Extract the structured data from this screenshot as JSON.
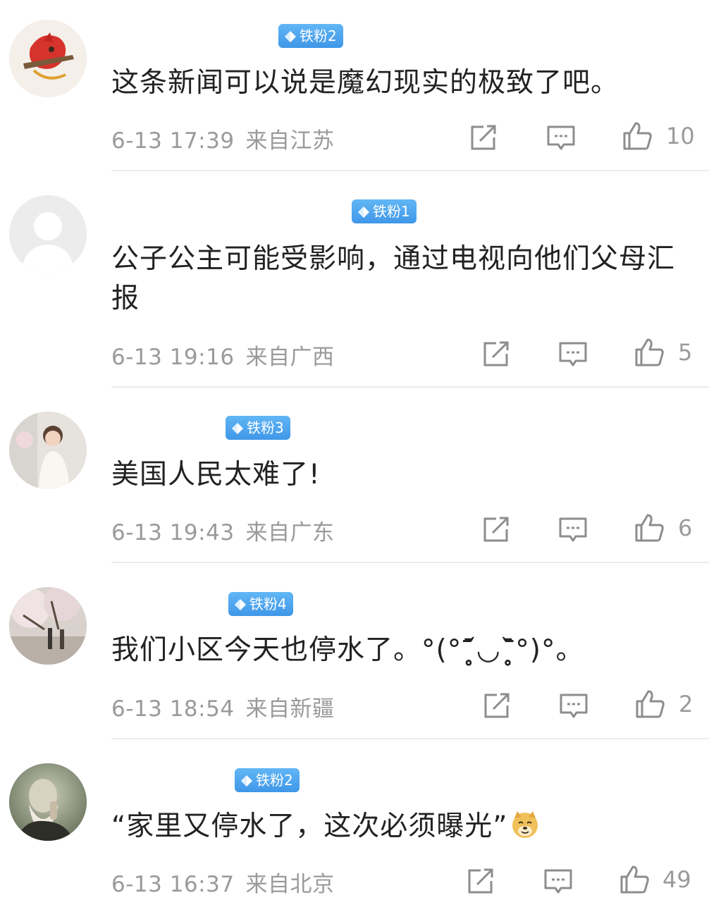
{
  "colors": {
    "badge": "#4aa3ee",
    "meta_text": "#9a9a9a",
    "body_text": "#222222",
    "divider": "#ececec"
  },
  "comments": [
    {
      "badge": "铁粉2",
      "text": "这条新闻可以说是魔幻现实的极致了吧。",
      "time": "6-13 17:39",
      "location": "来自江苏",
      "likes": "10",
      "avatar": "red-drawing-avatar"
    },
    {
      "badge": "铁粉1",
      "text": "公子公主可能受影响，通过电视向他们父母汇报",
      "time": "6-13 19:16",
      "location": "来自广西",
      "likes": "5",
      "avatar": "default-gray-avatar"
    },
    {
      "badge": "铁粉3",
      "text": "美国人民太难了!",
      "time": "6-13 19:43",
      "location": "来自广东",
      "likes": "6",
      "avatar": "child-photo-avatar"
    },
    {
      "badge": "铁粉4",
      "text": "我们小区今天也停水了。°(°ˉ̥̥̥̥̥̥̥̥᷄◡ˉ̥̥̥̥̥̥̥̥᷅°)°。",
      "time": "6-13 18:54",
      "location": "来自新疆",
      "likes": "2",
      "avatar": "cherry-blossom-photo-avatar"
    },
    {
      "badge": "铁粉2",
      "text": "“家里又停水了，这次必须曝光”",
      "emoji": "doge-emoji",
      "time": "6-13 16:37",
      "location": "来自北京",
      "likes": "49",
      "avatar": "darwin-portrait-avatar"
    }
  ]
}
